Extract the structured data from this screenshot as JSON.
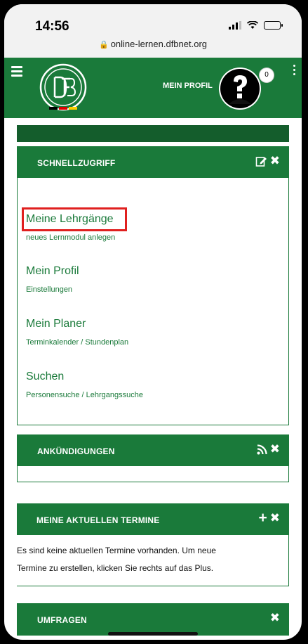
{
  "status_bar": {
    "time": "14:56"
  },
  "browser": {
    "url": "online-lernen.dfbnet.org"
  },
  "header": {
    "profile_label": "MEIN PROFIL",
    "notification_count": "0"
  },
  "quick_access": {
    "title": "SCHNELLZUGRIFF",
    "items": [
      {
        "title": "Meine Lehrgänge",
        "sub": "neues Lernmodul anlegen"
      },
      {
        "title": "Mein Profil",
        "sub": "Einstellungen"
      },
      {
        "title": "Mein Planer",
        "sub": "Terminkalender / Stundenplan"
      },
      {
        "title": "Suchen",
        "sub": "Personensuche / Lehrgangssuche"
      }
    ]
  },
  "announcements": {
    "title": "ANKÜNDIGUNGEN"
  },
  "appointments": {
    "title": "MEINE AKTUELLEN TERMINE",
    "line1": "Es sind keine aktuellen Termine vorhanden. Um neue",
    "line2": "Termine zu erstellen, klicken Sie rechts auf das Plus."
  },
  "surveys": {
    "title": "UMFRAGEN"
  },
  "colors": {
    "primary_green": "#1a7a3a",
    "dark_green": "#145d2c",
    "highlight_red": "#e0201f"
  }
}
